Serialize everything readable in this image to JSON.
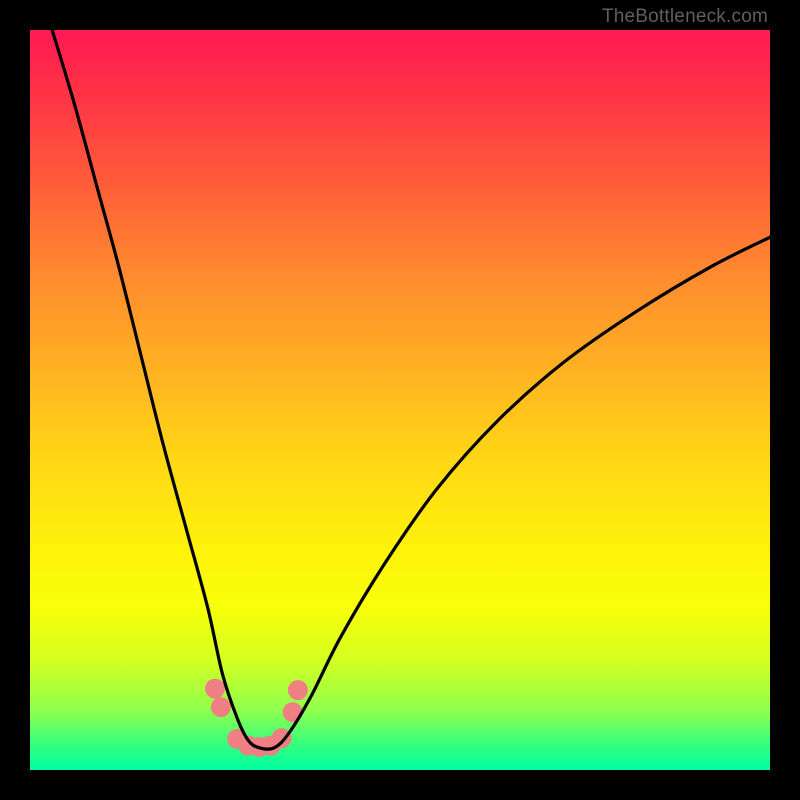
{
  "watermark": "TheBottleneck.com",
  "chart_data": {
    "type": "line",
    "title": "",
    "xlabel": "",
    "ylabel": "",
    "xlim": [
      0,
      100
    ],
    "ylim": [
      0,
      100
    ],
    "curve": {
      "x": [
        3,
        6,
        9,
        12,
        15,
        18,
        21,
        24,
        26,
        28,
        29.5,
        31,
        33,
        35,
        38,
        42,
        48,
        55,
        63,
        72,
        82,
        92,
        100
      ],
      "y": [
        100,
        90,
        79,
        68,
        56,
        44,
        33,
        22,
        13,
        7,
        4,
        3,
        3,
        5,
        10,
        18,
        28,
        38,
        47,
        55,
        62,
        68,
        72
      ]
    },
    "markers": {
      "x": [
        25.0,
        25.8,
        28.0,
        29.5,
        31.0,
        32.5,
        34.0,
        35.5,
        36.2
      ],
      "y": [
        11.0,
        8.5,
        4.2,
        3.3,
        3.1,
        3.3,
        4.3,
        7.8,
        10.8
      ],
      "color": "#ee8083",
      "radius_px": 10
    },
    "background_gradient": {
      "top": "#ff1a54",
      "bottom": "#00ffa2"
    }
  }
}
